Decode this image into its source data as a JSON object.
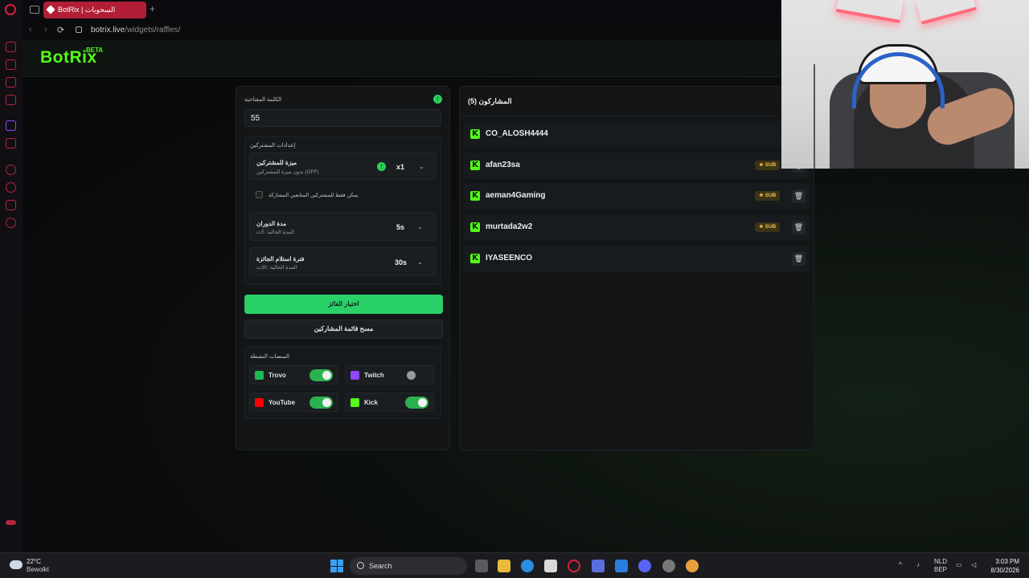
{
  "browser": {
    "tab_title": "BotRix | السحوبات",
    "url_host": "botrix.live",
    "url_path": "/widgets/raffles/"
  },
  "app": {
    "logo": "BotRix",
    "logo_badge": "BETA"
  },
  "raffle": {
    "keyword_label": "الكلمة المفتاحية",
    "keyword_value": "55",
    "settings_title": "إعدادات المشتركين",
    "subscriber_perk": {
      "title": "ميزة للمشتركين",
      "subtitle": "بدون ميزة للمشتركين (OFF)",
      "value": "x1"
    },
    "subs_only_label": "يمكن فقط للمشتركين المتابعين المشاركة",
    "spin_duration": {
      "title": "مدة الدوران",
      "subtitle": "المدة الحالية: 5ث",
      "value": "5s"
    },
    "claim_period": {
      "title": "فترة استلام الجائزة",
      "subtitle": "المدة الحالية: 30ث",
      "value": "30s"
    },
    "pick_winner_label": "اختيار الفائز",
    "clear_list_label": "مسح قائمة المشاركين",
    "platforms_title": "المنصات النشطة",
    "platforms": [
      {
        "name": "Trovo",
        "enabled": true,
        "color": "#1db954"
      },
      {
        "name": "Twitch",
        "enabled": false,
        "color": "#9146ff"
      },
      {
        "name": "YouTube",
        "enabled": true,
        "color": "#ff0000"
      },
      {
        "name": "Kick",
        "enabled": true,
        "color": "#53fc18"
      }
    ]
  },
  "participants": {
    "title": "المشاركون (5)",
    "list": [
      {
        "name": "CO_ALOSH4444",
        "sub": false
      },
      {
        "name": "afan23sa",
        "sub": true
      },
      {
        "name": "aeman4Gaming",
        "sub": true
      },
      {
        "name": "murtada2w2",
        "sub": true
      },
      {
        "name": "IYASEENCO",
        "sub": false
      }
    ],
    "sub_badge": "SUB"
  },
  "taskbar": {
    "temperature": "22°C",
    "weather": "Bewolkt",
    "search_label": "Search",
    "lang_top": "NLD",
    "lang_bottom": "BEP",
    "time": "3:03 PM",
    "date": "8/30/2026"
  }
}
